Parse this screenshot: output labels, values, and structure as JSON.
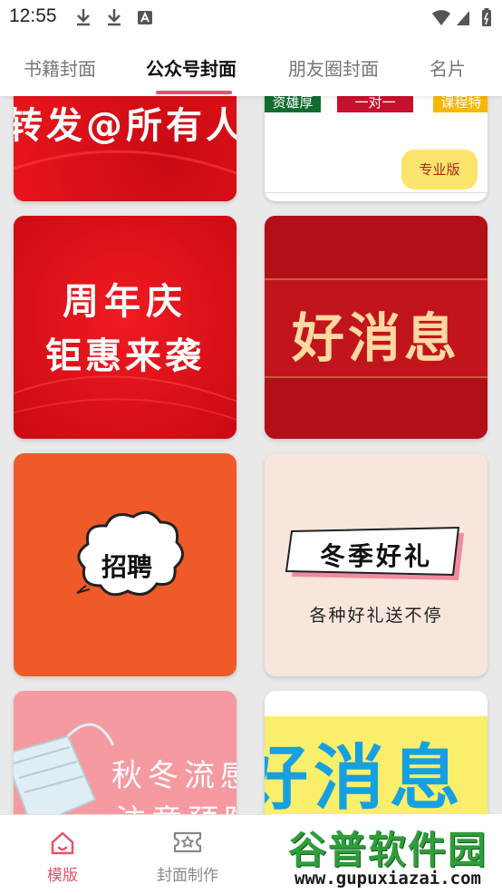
{
  "status_bar": {
    "time": "12:55"
  },
  "tabs": [
    {
      "label": "书籍封面",
      "active": false
    },
    {
      "label": "公众号封面",
      "active": true
    },
    {
      "label": "朋友圈封面",
      "active": false
    },
    {
      "label": "名片",
      "active": false
    }
  ],
  "cards": {
    "c1": {
      "text": "转发@所有人"
    },
    "c2": {
      "tag1": "资雄厚",
      "tag2": "一对一",
      "tag3": "课程特",
      "pro_badge": "专业版"
    },
    "c3": {
      "line1": "周年庆",
      "line2": "钜惠来袭"
    },
    "c4": {
      "text": "好消息"
    },
    "c5": {
      "text": "招聘"
    },
    "c6": {
      "title": "冬季好礼",
      "subtitle": "各种好礼送不停"
    },
    "c7": {
      "line1": "秋冬流感",
      "line2": "注意预防"
    },
    "c8": {
      "text": "好消息"
    }
  },
  "bottom_nav": [
    {
      "label": "模版",
      "icon": "home-icon",
      "active": true
    },
    {
      "label": "封面制作",
      "icon": "cover-make-icon",
      "active": false
    }
  ],
  "watermark": {
    "title": "谷普软件园",
    "url": "www.gupuxiazai.com"
  },
  "colors": {
    "accent": "#e8526a",
    "red": "#e3141b",
    "orange": "#f05a28",
    "cream": "#f6e6dc",
    "pink": "#f59aa0",
    "yellow_badge": "#fbe46e",
    "blue_text": "#17a0e0"
  }
}
